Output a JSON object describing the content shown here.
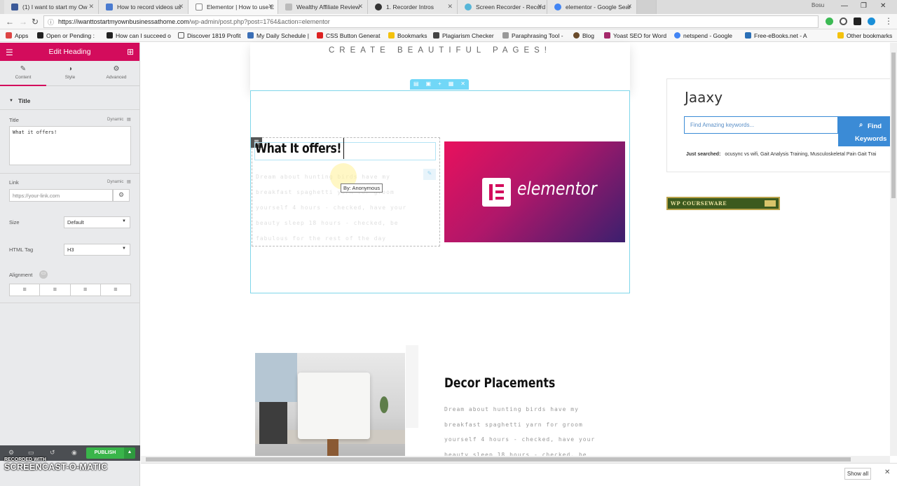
{
  "browser": {
    "tabs": [
      {
        "title": "(1) I want to start my Ow",
        "color": "#3b5998"
      },
      {
        "title": "How to record videos us",
        "color": "#4a7bd0"
      },
      {
        "title": "Elementor | How to use E",
        "color": "#888888"
      },
      {
        "title": "Wealthy Affiliate Review",
        "color": "#888888"
      },
      {
        "title": "1. Recorder Intros",
        "color": "#333333"
      },
      {
        "title": "Screen Recorder - Record",
        "color": "#57b6d8"
      },
      {
        "title": "elementor - Google Sear",
        "color": "#4285f4"
      }
    ],
    "user_label": "Bosu",
    "url_host": "https://iwanttostartmyownbusinessathome.com",
    "url_path": "/wp-admin/post.php?post=1764&action=elementor",
    "bookmarks": [
      "Apps",
      "Open or Pending :",
      "How can I succeed o",
      "Discover 1819 Profit",
      "My Daily Schedule |",
      "CSS Button Generat",
      "Bookmarks",
      "Plagiarism Checker",
      "Paraphrasing Tool -",
      "Blog",
      "Yoast SEO for Word",
      "netspend - Google",
      "Free-eBooks.net - A",
      "Other bookmarks"
    ]
  },
  "panel": {
    "header_title": "Edit Heading",
    "tabs": [
      "Content",
      "Style",
      "Advanced"
    ],
    "section_title": "Title",
    "title_label": "Title",
    "dynamic_label": "Dynamic",
    "title_value": "What it offers!",
    "link_label": "Link",
    "link_placeholder": "https://your-link.com",
    "size_label": "Size",
    "size_value": "Default",
    "html_tag_label": "HTML Tag",
    "html_tag_value": "H3",
    "alignment_label": "Alignment",
    "publish_label": "PUBLISH"
  },
  "canvas": {
    "top_tagline": "CREATE BEAUTIFUL PAGES!",
    "heading": "What It offers!",
    "tooltip": "By: Anonymous",
    "faded_text": "Dream about hunting birds have my breakfast spaghetti yarn for groom yourself 4 hours - checked, have your beauty sleep 18 hours - checked, be fabulous for the rest of the day",
    "image_word": "elementor",
    "jaaxy_logo": "Jaaxy",
    "jaaxy_placeholder": "Find Amazing keywords...",
    "jaaxy_button_line1": "Find",
    "jaaxy_button_line2": "Keywords",
    "jaaxy_searched_label": "Just searched:",
    "jaaxy_searched_terms": "ocusync vs wifi, Gait Analysis Training, Musculoskeletal Pain Gait Trai",
    "wp_banner": "WP COURSEWARE",
    "decor_title": "Decor Placements",
    "decor_body": "Dream about hunting birds have my breakfast spaghetti yarn for groom yourself 4 hours - checked, have your beauty sleep 18 hours - checked, be fabulous for the rest of the day"
  },
  "download_bar": {
    "show_all": "Show all"
  },
  "watermark": {
    "line1": "RECORDED WITH",
    "line2": "SCREENCAST-O-MATIC"
  }
}
